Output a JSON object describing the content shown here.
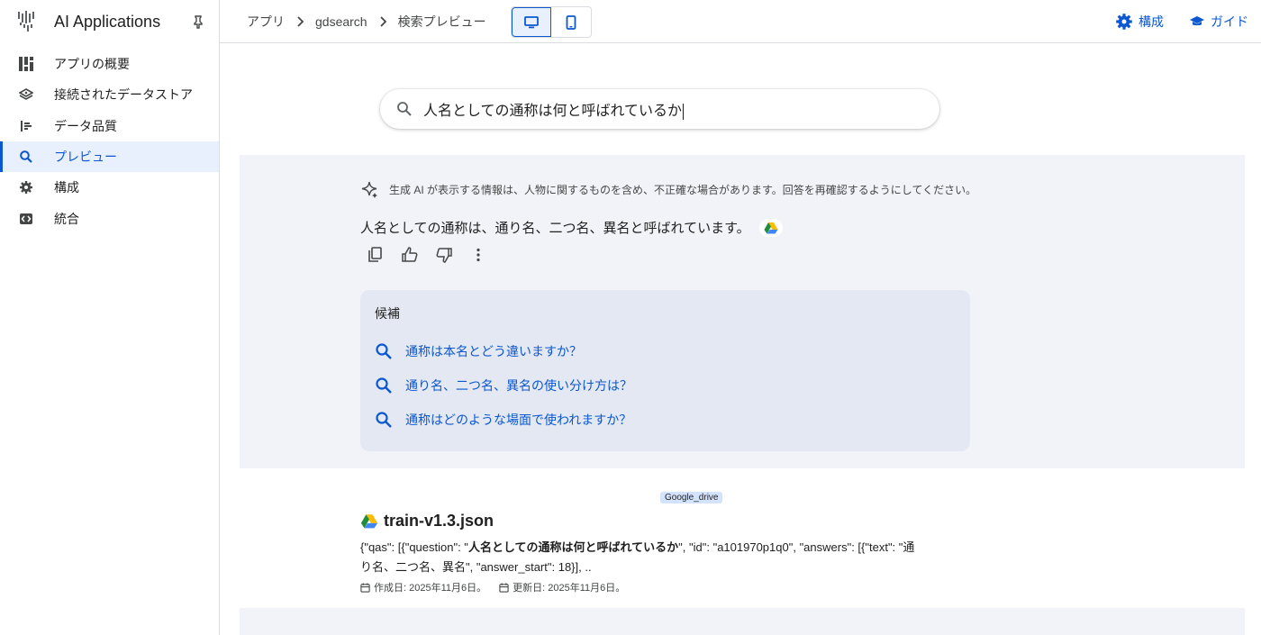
{
  "app": {
    "title": "AI Applications"
  },
  "sidebar": {
    "items": [
      {
        "label": "アプリの概要",
        "icon": "dashboard-icon",
        "active": false
      },
      {
        "label": "接続されたデータストア",
        "icon": "datastore-icon",
        "active": false
      },
      {
        "label": "データ品質",
        "icon": "quality-icon",
        "active": false
      },
      {
        "label": "プレビュー",
        "icon": "search-icon",
        "active": true
      },
      {
        "label": "構成",
        "icon": "gear-icon",
        "active": false
      },
      {
        "label": "統合",
        "icon": "integration-icon",
        "active": false
      }
    ]
  },
  "breadcrumb": [
    "アプリ",
    "gdsearch",
    "検索プレビュー"
  ],
  "topbar": {
    "config_label": "構成",
    "guide_label": "ガイド"
  },
  "search": {
    "query": "人名としての通称は何と呼ばれているか"
  },
  "answer": {
    "disclaimer": "生成 AI が表示する情報は、人物に関するものを含め、不正確な場合があります。回答を再確認するようにしてください。",
    "text": "人名としての通称は、通り名、二つ名、異名と呼ばれています。"
  },
  "suggestions": {
    "header": "候補",
    "items": [
      "通称は本名とどう違いますか？",
      "通り名、二つ名、異名の使い分け方は？",
      "通称はどのような場面で使われますか？"
    ]
  },
  "result": {
    "source_badge": "Google_drive",
    "title": "train-v1.3.json",
    "snippet_pre": "{\"qas\": [{\"question\": \"",
    "snippet_bold": "人名としての通称は何と呼ばれているか",
    "snippet_post": "\", \"id\": \"a101970p1q0\", \"answers\": [{\"text\": \"通り名、二つ名、異名\", \"answer_start\": 18}], ..",
    "created": "作成日: 2025年11月6日。",
    "updated": "更新日: 2025年11月6日。"
  },
  "colors": {
    "accent": "#0b57d0",
    "active_bg": "#e8f0fe",
    "answer_bg": "#f1f3f8"
  }
}
